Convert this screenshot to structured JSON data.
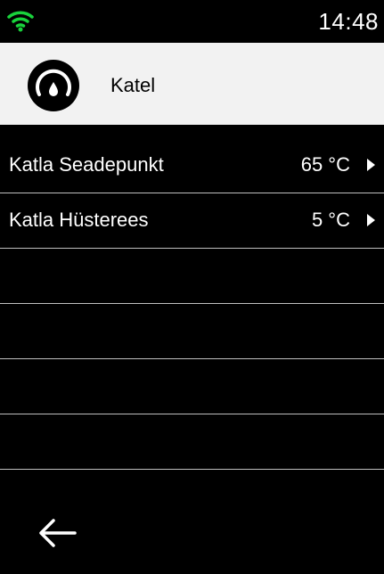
{
  "status_bar": {
    "wifi_icon": "wifi-icon",
    "wifi_color": "#19d23c",
    "time": "14:48"
  },
  "header": {
    "icon": "boiler-gauge-icon",
    "title": "Katel"
  },
  "settings": [
    {
      "label": "Katla Seadepunkt",
      "value": "65 °C"
    },
    {
      "label": "Katla Hüsterees",
      "value": "5 °C"
    },
    {
      "label": "",
      "value": ""
    },
    {
      "label": "",
      "value": ""
    },
    {
      "label": "",
      "value": ""
    },
    {
      "label": "",
      "value": ""
    }
  ],
  "footer": {
    "back_icon": "back-arrow-icon"
  }
}
